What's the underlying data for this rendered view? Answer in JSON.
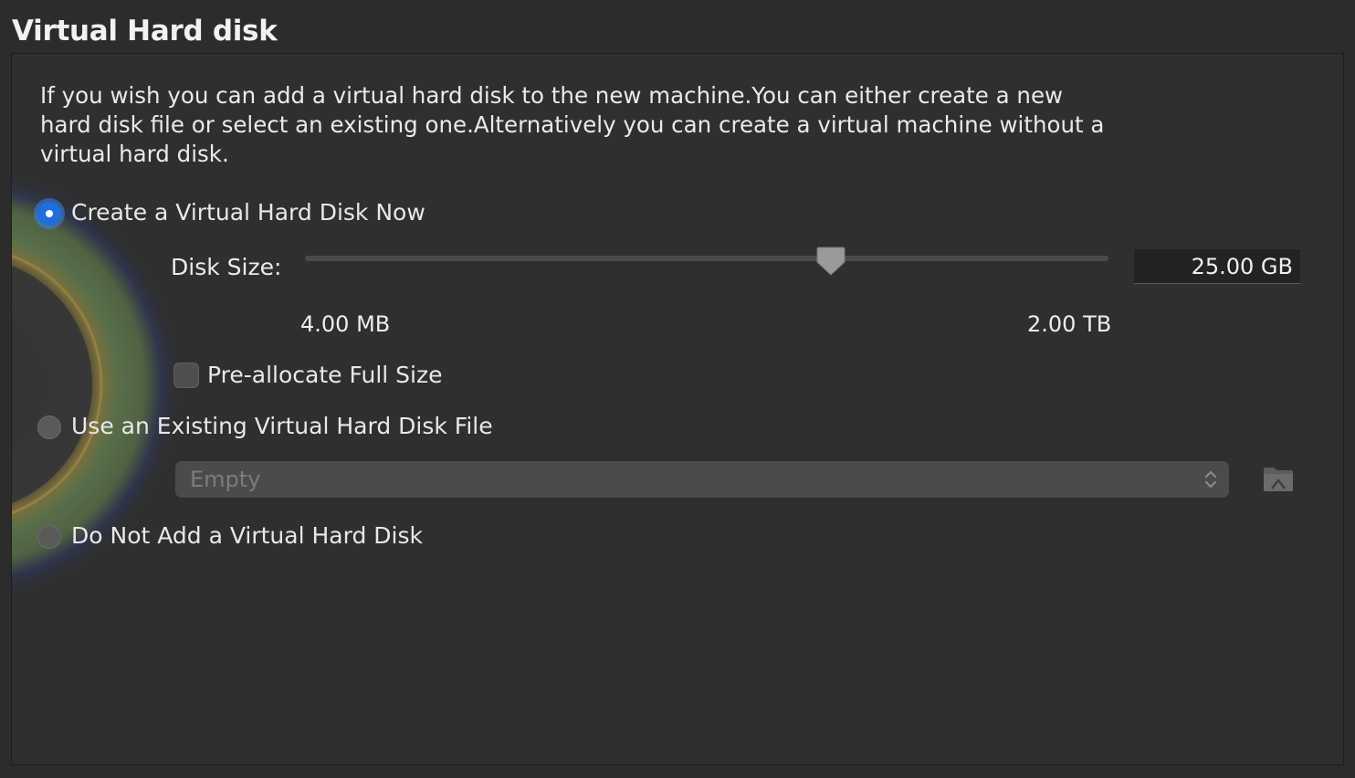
{
  "page": {
    "title": "Virtual Hard disk",
    "intro": "If you wish you can add a virtual hard disk to the new machine.You can either create a new hard disk file or select an existing one.Alternatively you can create a virtual machine without a virtual hard disk."
  },
  "options": {
    "create_now": {
      "label": "Create a Virtual Hard Disk Now",
      "selected": true
    },
    "use_existing": {
      "label": "Use an Existing Virtual Hard Disk File",
      "selected": false
    },
    "do_not_add": {
      "label": "Do Not Add a Virtual Hard Disk",
      "selected": false
    }
  },
  "disk_size": {
    "label": "Disk Size:",
    "value": "25.00 GB",
    "min_label": "4.00 MB",
    "max_label": "2.00 TB",
    "slider_fraction": 0.655
  },
  "preallocate": {
    "label": "Pre-allocate Full Size",
    "checked": false
  },
  "existing_file": {
    "selected_value": "Empty"
  },
  "icons": {
    "folder": "folder-icon",
    "select_arrows": "chevron-up-down-icon",
    "slider_thumb": "slider-thumb-icon"
  },
  "colors": {
    "accent": "#1e6fdc",
    "background": "#2f2f2f"
  }
}
